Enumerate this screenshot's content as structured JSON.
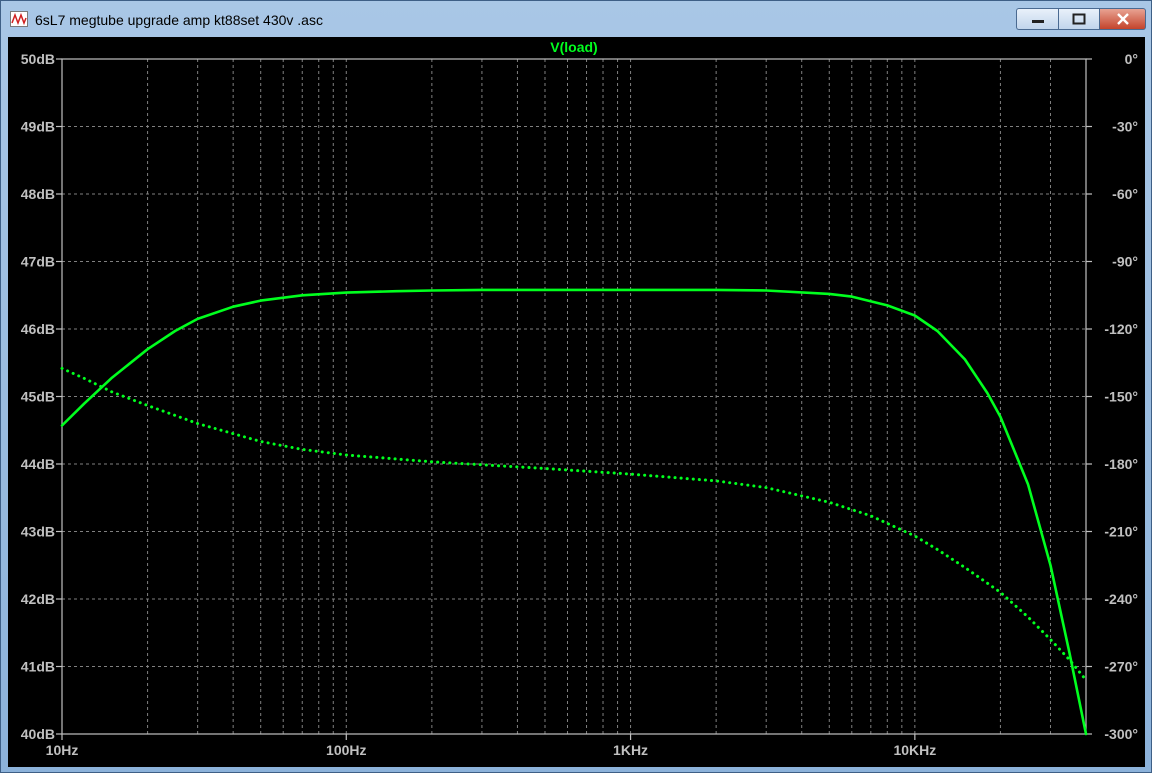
{
  "window": {
    "title": "6sL7 megtube upgrade amp  kt88set 430v .asc",
    "minimize_label": "—",
    "maximize_label": "",
    "close_label": "✕"
  },
  "colors": {
    "trace": "#00ff1e",
    "axis_label": "#c0c0c0",
    "grid": "#808080",
    "background": "#000000"
  },
  "chart_data": {
    "type": "line",
    "title": "V(load)",
    "x_scale": "log",
    "xlim": [
      10,
      40000
    ],
    "x_ticks": [
      {
        "value": 10,
        "label": "10Hz"
      },
      {
        "value": 100,
        "label": "100Hz"
      },
      {
        "value": 1000,
        "label": "1KHz"
      },
      {
        "value": 10000,
        "label": "10KHz"
      }
    ],
    "ylim_left": [
      40,
      50
    ],
    "y_ticks_left": [
      "40dB",
      "41dB",
      "42dB",
      "43dB",
      "44dB",
      "45dB",
      "46dB",
      "47dB",
      "48dB",
      "49dB",
      "50dB"
    ],
    "ylim_right": [
      -300,
      0
    ],
    "y_ticks_right": [
      "-300°",
      "-270°",
      "-240°",
      "-210°",
      "-180°",
      "-150°",
      "-120°",
      "-90°",
      "-60°",
      "-30°",
      "0°"
    ],
    "grid": true,
    "series": [
      {
        "axis": "left",
        "style": "solid",
        "x": [
          10,
          12,
          15,
          20,
          25,
          30,
          40,
          50,
          70,
          100,
          150,
          200,
          300,
          500,
          1000,
          2000,
          3000,
          5000,
          6000,
          8000,
          10000,
          12000,
          15000,
          18000,
          20000,
          25000,
          30000,
          35000,
          40000
        ],
        "values": [
          44.57,
          44.9,
          45.28,
          45.7,
          45.97,
          46.15,
          46.33,
          46.42,
          46.5,
          46.54,
          46.56,
          46.57,
          46.58,
          46.58,
          46.58,
          46.58,
          46.57,
          46.52,
          46.48,
          46.35,
          46.2,
          45.97,
          45.55,
          45.05,
          44.7,
          43.7,
          42.5,
          41.2,
          40.0
        ]
      },
      {
        "axis": "right",
        "style": "dotted",
        "x": [
          10,
          12,
          15,
          20,
          30,
          50,
          70,
          100,
          200,
          500,
          1000,
          2000,
          3000,
          5000,
          7000,
          10000,
          12000,
          15000,
          20000,
          25000,
          30000,
          35000,
          40000
        ],
        "values": [
          -137.5,
          -142,
          -148,
          -154,
          -162,
          -170,
          -173.5,
          -176,
          -179,
          -182,
          -184.5,
          -187.5,
          -190.5,
          -197,
          -203,
          -212,
          -218,
          -226,
          -237,
          -248,
          -258,
          -267,
          -276
        ]
      }
    ]
  }
}
